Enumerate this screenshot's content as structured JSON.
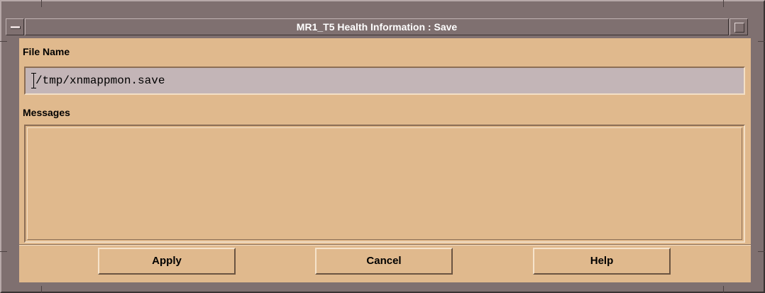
{
  "window": {
    "title": "MR1_T5 Health Information : Save"
  },
  "file_name": {
    "label": "File Name",
    "value": "/tmp/xnmappmon.save"
  },
  "messages": {
    "label": "Messages",
    "content": ""
  },
  "buttons": {
    "apply": "Apply",
    "cancel": "Cancel",
    "help": "Help"
  },
  "colors": {
    "frame": "#7f7070",
    "client_background": "#e0b98d",
    "text_field_background": "#c3b5b7"
  }
}
